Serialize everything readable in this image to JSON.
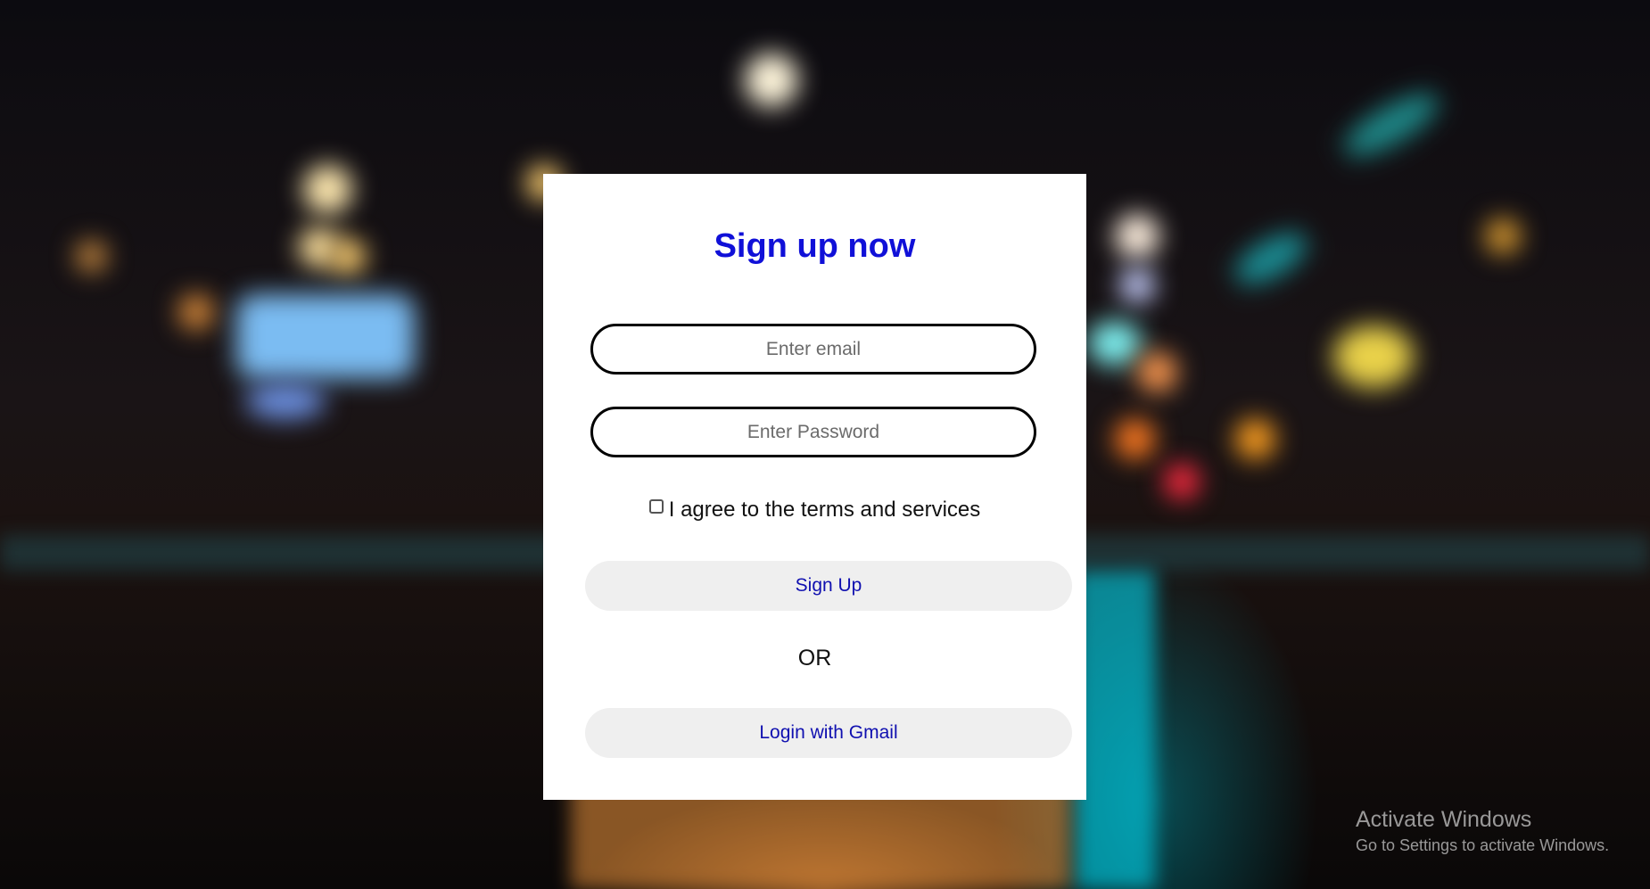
{
  "signup": {
    "title": "Sign up now",
    "email_placeholder": "Enter email",
    "password_placeholder": "Enter Password",
    "terms_label": "I agree to the terms and services",
    "terms_checked": false,
    "signup_button": "Sign Up",
    "or_text": "OR",
    "gmail_button": "Login with Gmail"
  },
  "colors": {
    "title": "#1010d8",
    "button_text": "#1010b0",
    "button_bg": "#efefef",
    "card_bg": "#ffffff"
  },
  "watermark": {
    "title": "Activate Windows",
    "subtitle": "Go to Settings to activate Windows."
  }
}
